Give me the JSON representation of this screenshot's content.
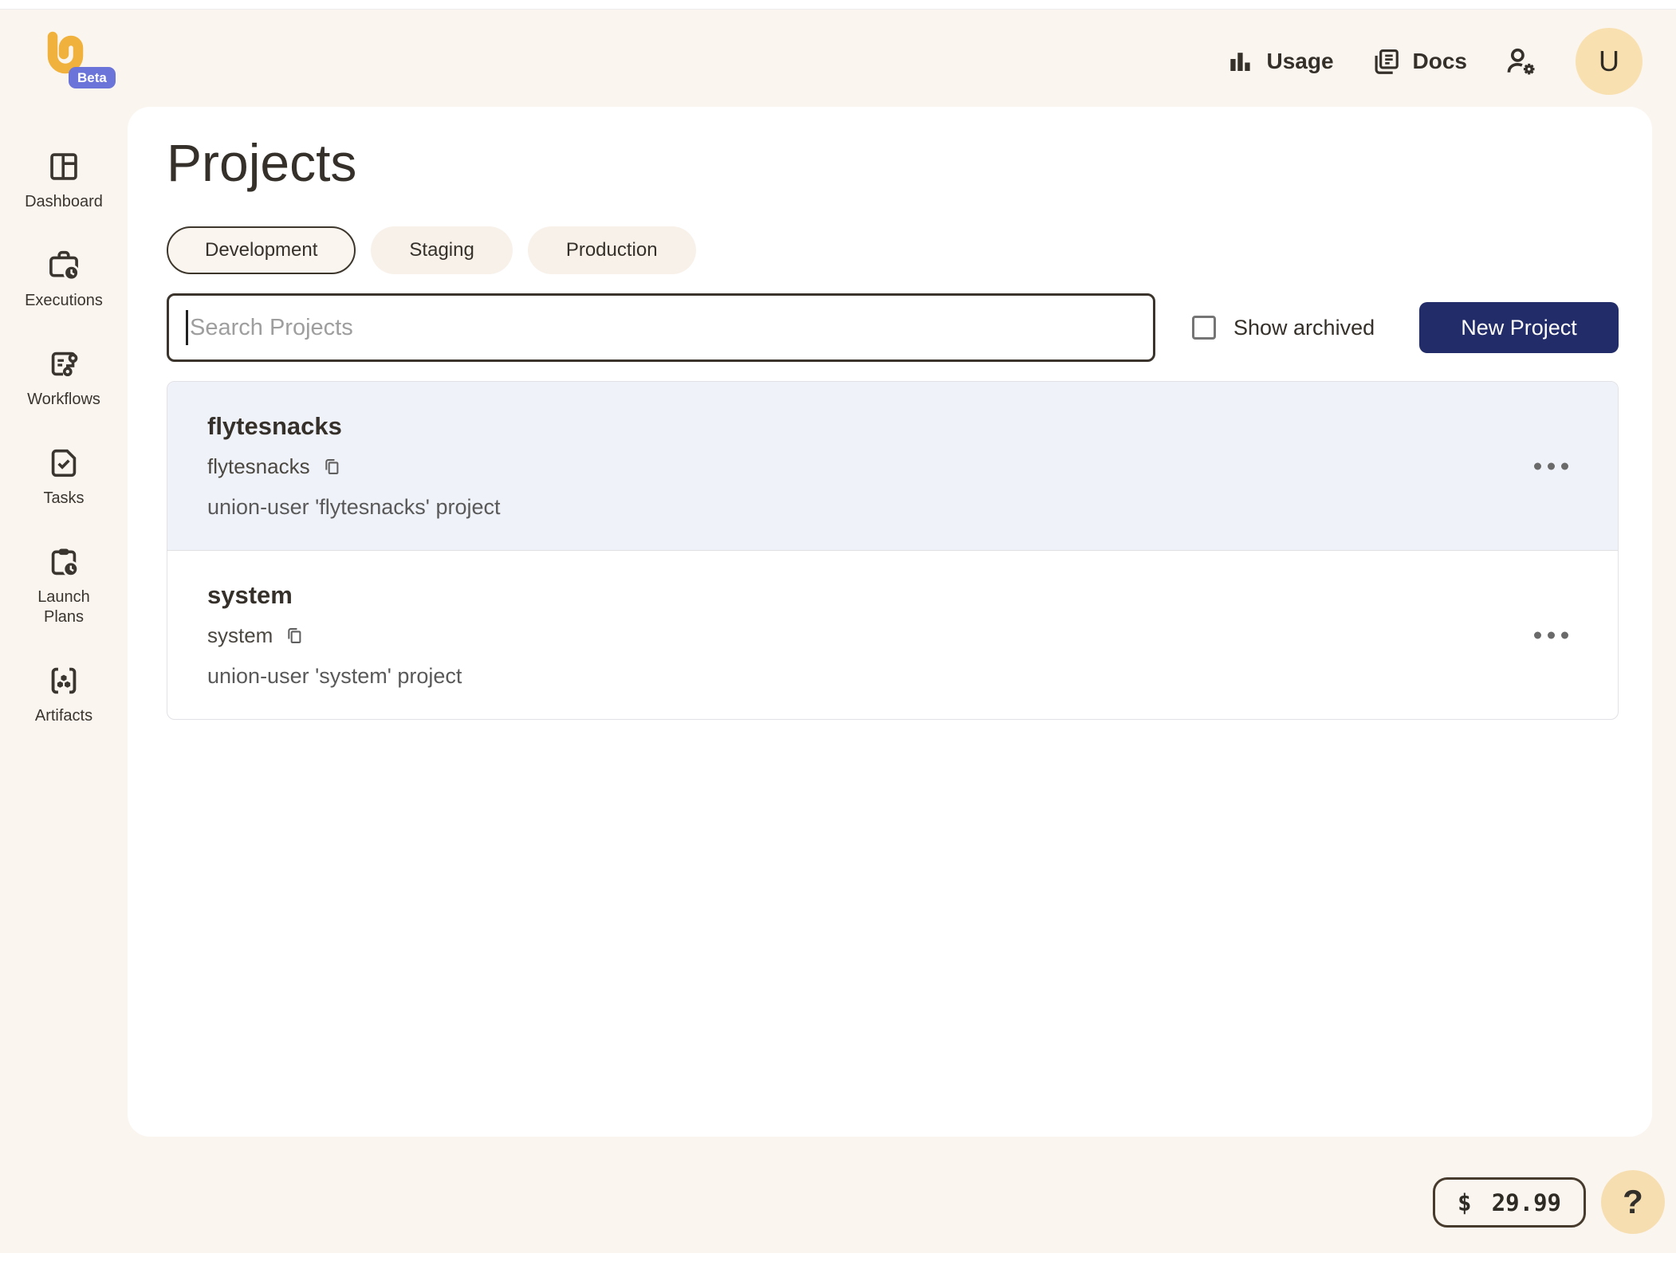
{
  "header": {
    "usage_label": "Usage",
    "docs_label": "Docs",
    "avatar_initial": "U",
    "beta_label": "Beta",
    "icons": [
      "bar-chart-icon",
      "docs-icon",
      "manage-accounts-icon"
    ]
  },
  "sidebar": {
    "items": [
      {
        "label": "Dashboard",
        "icon": "dashboard-icon"
      },
      {
        "label": "Executions",
        "icon": "executions-icon"
      },
      {
        "label": "Workflows",
        "icon": "workflows-icon"
      },
      {
        "label": "Tasks",
        "icon": "tasks-icon"
      },
      {
        "label": "Launch Plans",
        "icon": "launch-plans-icon"
      },
      {
        "label": "Artifacts",
        "icon": "artifacts-icon"
      }
    ]
  },
  "main": {
    "title": "Projects",
    "domain_tabs": [
      {
        "label": "Development",
        "selected": true
      },
      {
        "label": "Staging",
        "selected": false
      },
      {
        "label": "Production",
        "selected": false
      }
    ],
    "search": {
      "placeholder": "Search Projects",
      "value": ""
    },
    "show_archived_label": "Show archived",
    "show_archived_checked": false,
    "new_project_label": "New Project",
    "projects": [
      {
        "name": "flytesnacks",
        "id": "flytesnacks",
        "description": "union-user 'flytesnacks' project",
        "highlighted": true
      },
      {
        "name": "system",
        "id": "system",
        "description": "union-user 'system' project",
        "highlighted": false
      }
    ]
  },
  "footer": {
    "currency_symbol": "$",
    "amount": "29.99",
    "help_label": "?"
  },
  "colors": {
    "background_cream": "#fbf5ef",
    "panel_white": "#ffffff",
    "accent_navy": "#222c68",
    "row_highlight": "#f0f2f9",
    "brand_orange": "#f0b23c",
    "beta_badge": "#6b74d9",
    "avatar_bg": "#f8e0b0",
    "help_fab_bg": "#f6deb0",
    "dark_text": "#35312a"
  }
}
